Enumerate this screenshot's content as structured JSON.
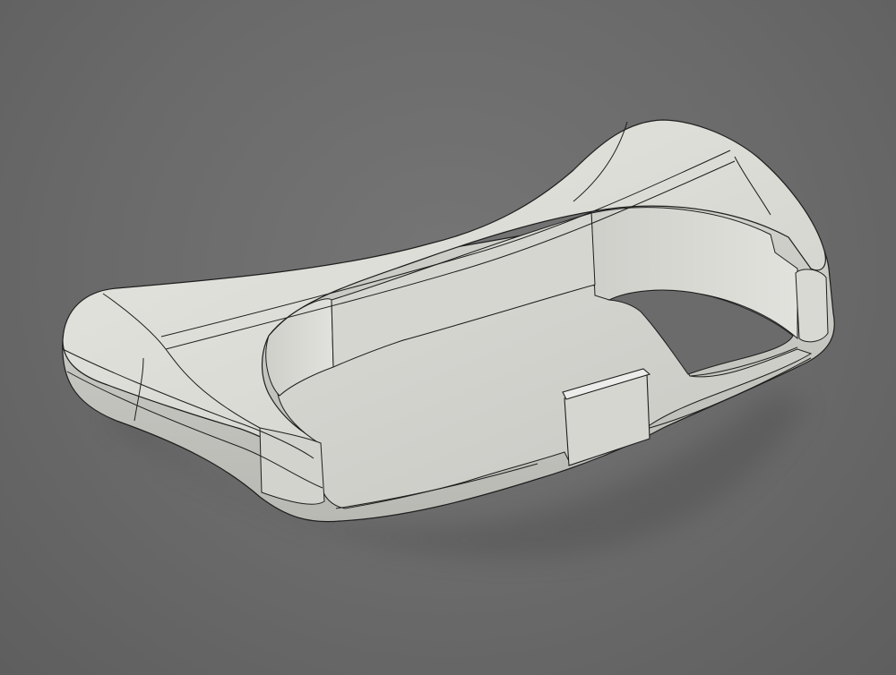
{
  "viewport": {
    "background_color": "#6b6b6b",
    "model_color": "#dcdcd6",
    "edge_color": "#1e1e1e",
    "display_mode": "shaded-with-visible-edges"
  }
}
